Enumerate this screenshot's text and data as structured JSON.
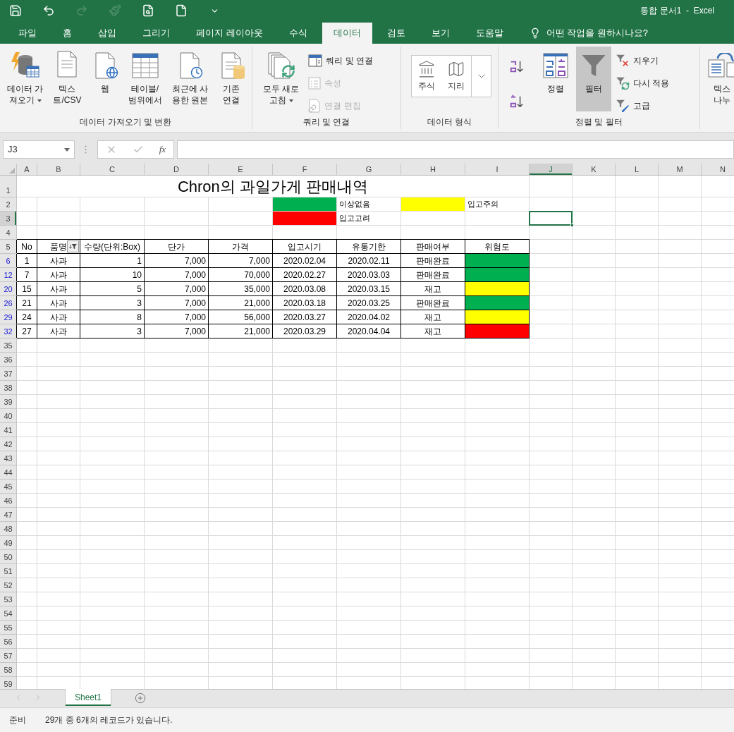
{
  "title_bar": {
    "quick_access": [
      {
        "kind": "save",
        "disabled": false
      },
      {
        "kind": "undo",
        "disabled": false
      },
      {
        "kind": "redo",
        "disabled": true
      },
      {
        "kind": "format",
        "disabled": true
      },
      {
        "kind": "preview",
        "disabled": false
      },
      {
        "kind": "new",
        "disabled": false
      },
      {
        "kind": "customize",
        "disabled": false
      }
    ],
    "title": "통합 문서1  -  Excel"
  },
  "ribbon_tabs": [
    {
      "label": "파일",
      "selected": false
    },
    {
      "label": "홈",
      "selected": false
    },
    {
      "label": "삽입",
      "selected": false
    },
    {
      "label": "그리기",
      "selected": false
    },
    {
      "label": "페이지 레이아웃",
      "selected": false
    },
    {
      "label": "수식",
      "selected": false
    },
    {
      "label": "데이터",
      "selected": true
    },
    {
      "label": "검토",
      "selected": false
    },
    {
      "label": "보기",
      "selected": false
    },
    {
      "label": "도움말",
      "selected": false
    }
  ],
  "tell_me": "어떤 작업을 원하시나요?",
  "ribbon_groups": [
    {
      "label": "데이터 가져오기 및 변환",
      "items": [
        {
          "kind": "large",
          "lines": [
            "데이터 가",
            "져오기"
          ],
          "dropdown": true,
          "on": false
        },
        {
          "kind": "large",
          "lines": [
            "텍스",
            "트/CSV"
          ],
          "dropdown": false,
          "on": false
        },
        {
          "kind": "large",
          "lines": [
            "웹"
          ],
          "dropdown": false,
          "on": false
        },
        {
          "kind": "large",
          "lines": [
            "테이블/",
            "범위에서"
          ],
          "dropdown": false,
          "on": false
        },
        {
          "kind": "large",
          "lines": [
            "최근에 사",
            "용한 원본"
          ],
          "dropdown": false,
          "on": false
        },
        {
          "kind": "large",
          "lines": [
            "기존",
            "연결"
          ],
          "dropdown": false,
          "on": false
        }
      ]
    },
    {
      "label": "쿼리 및 연결",
      "items": [
        {
          "kind": "large",
          "lines": [
            "모두 새로",
            "고침"
          ],
          "dropdown": true,
          "on": false
        },
        {
          "kind": "small_stack",
          "items": [
            {
              "label": "쿼리 및 연결",
              "disabled": false
            },
            {
              "label": "속성",
              "disabled": true
            },
            {
              "label": "연결 편집",
              "disabled": true
            }
          ]
        }
      ]
    },
    {
      "label": "데이터 형식",
      "items": [
        {
          "kind": "gallery",
          "options": [
            "주식",
            "지리"
          ]
        }
      ]
    },
    {
      "label": "정렬 및 필터",
      "items": [
        {
          "kind": "sort_pair"
        },
        {
          "kind": "large",
          "lines": [
            "정렬"
          ],
          "dropdown": false,
          "on": false
        },
        {
          "kind": "large",
          "lines": [
            "필터"
          ],
          "dropdown": false,
          "on": true
        },
        {
          "kind": "small_stack",
          "items": [
            {
              "label": "지우기",
              "disabled": false
            },
            {
              "label": "다시 적용",
              "disabled": false
            },
            {
              "label": "고급",
              "disabled": false
            }
          ]
        }
      ]
    },
    {
      "items": [
        {
          "kind": "large",
          "lines": [
            "텍스",
            "나누"
          ],
          "dropdown": false,
          "on": false
        }
      ]
    }
  ],
  "formula_bar": {
    "name_box": "J3",
    "function_label": "fx"
  },
  "sheet": {
    "columns": [
      {
        "label": "A",
        "selected": false
      },
      {
        "label": "B",
        "selected": false
      },
      {
        "label": "C",
        "selected": false
      },
      {
        "label": "D",
        "selected": false
      },
      {
        "label": "E",
        "selected": false
      },
      {
        "label": "F",
        "selected": false
      },
      {
        "label": "G",
        "selected": false
      },
      {
        "label": "H",
        "selected": false
      },
      {
        "label": "I",
        "selected": false
      },
      {
        "label": "J",
        "selected": true
      },
      {
        "label": "K",
        "selected": false
      },
      {
        "label": "L",
        "selected": false
      },
      {
        "label": "M",
        "selected": false
      },
      {
        "label": "N",
        "selected": false
      }
    ],
    "row_headers": [
      {
        "label": "1",
        "filtered": false,
        "selected": false
      },
      {
        "label": "2",
        "filtered": false,
        "selected": false
      },
      {
        "label": "3",
        "filtered": false,
        "selected": true
      },
      {
        "label": "4",
        "filtered": false,
        "selected": false
      },
      {
        "label": "5",
        "filtered": false,
        "selected": false
      },
      {
        "label": "6",
        "filtered": true,
        "selected": false
      },
      {
        "label": "12",
        "filtered": true,
        "selected": false
      },
      {
        "label": "20",
        "filtered": true,
        "selected": false
      },
      {
        "label": "26",
        "filtered": true,
        "selected": false
      },
      {
        "label": "29",
        "filtered": true,
        "selected": false
      },
      {
        "label": "32",
        "filtered": true,
        "selected": false
      },
      {
        "label": "35",
        "filtered": false,
        "selected": false
      },
      {
        "label": "36",
        "filtered": false,
        "selected": false
      },
      {
        "label": "37",
        "filtered": false,
        "selected": false
      },
      {
        "label": "38",
        "filtered": false,
        "selected": false
      },
      {
        "label": "39",
        "filtered": false,
        "selected": false
      },
      {
        "label": "40",
        "filtered": false,
        "selected": false
      },
      {
        "label": "41",
        "filtered": false,
        "selected": false
      },
      {
        "label": "42",
        "filtered": false,
        "selected": false
      },
      {
        "label": "43",
        "filtered": false,
        "selected": false
      },
      {
        "label": "44",
        "filtered": false,
        "selected": false
      },
      {
        "label": "45",
        "filtered": false,
        "selected": false
      },
      {
        "label": "46",
        "filtered": false,
        "selected": false
      },
      {
        "label": "47",
        "filtered": false,
        "selected": false
      },
      {
        "label": "48",
        "filtered": false,
        "selected": false
      },
      {
        "label": "49",
        "filtered": false,
        "selected": false
      },
      {
        "label": "50",
        "filtered": false,
        "selected": false
      },
      {
        "label": "51",
        "filtered": false,
        "selected": false
      },
      {
        "label": "52",
        "filtered": false,
        "selected": false
      },
      {
        "label": "53",
        "filtered": false,
        "selected": false
      },
      {
        "label": "54",
        "filtered": false,
        "selected": false
      },
      {
        "label": "55",
        "filtered": false,
        "selected": false
      },
      {
        "label": "56",
        "filtered": false,
        "selected": false
      },
      {
        "label": "57",
        "filtered": false,
        "selected": false
      },
      {
        "label": "58",
        "filtered": false,
        "selected": false
      },
      {
        "label": "59",
        "filtered": false,
        "selected": false
      }
    ],
    "title": "Chron의 과일가게 판매내역",
    "legend": [
      {
        "color": "#00b050",
        "label": "이상없음"
      },
      {
        "color": "#ffff00",
        "label": "입고주의"
      },
      {
        "color": "#ff0000",
        "label": "입고고려"
      }
    ],
    "table": {
      "headers": [
        {
          "label": "No",
          "filtered": false
        },
        {
          "label": "품명",
          "filtered": true
        },
        {
          "label": "수량(단위:Box)",
          "filtered": false
        },
        {
          "label": "단가",
          "filtered": false
        },
        {
          "label": "가격",
          "filtered": false
        },
        {
          "label": "입고시기",
          "filtered": false
        },
        {
          "label": "유통기한",
          "filtered": false
        },
        {
          "label": "판매여부",
          "filtered": false
        },
        {
          "label": "위험도",
          "filtered": false
        }
      ],
      "records": [
        {
          "cells": [
            "1",
            "사과",
            "1",
            "7,000",
            "7,000",
            "2020.02.04",
            "2020.02.11",
            "판매완료"
          ],
          "color": "#00b050"
        },
        {
          "cells": [
            "7",
            "사과",
            "10",
            "7,000",
            "70,000",
            "2020.02.27",
            "2020.03.03",
            "판매완료"
          ],
          "color": "#00b050"
        },
        {
          "cells": [
            "15",
            "사과",
            "5",
            "7,000",
            "35,000",
            "2020.03.08",
            "2020.03.15",
            "재고"
          ],
          "color": "#ffff00"
        },
        {
          "cells": [
            "21",
            "사과",
            "3",
            "7,000",
            "21,000",
            "2020.03.18",
            "2020.03.25",
            "판매완료"
          ],
          "color": "#00b050"
        },
        {
          "cells": [
            "24",
            "사과",
            "8",
            "7,000",
            "56,000",
            "2020.03.27",
            "2020.04.02",
            "재고"
          ],
          "color": "#ffff00"
        },
        {
          "cells": [
            "27",
            "사과",
            "3",
            "7,000",
            "21,000",
            "2020.03.29",
            "2020.04.04",
            "재고"
          ],
          "color": "#ff0000"
        }
      ]
    }
  },
  "sheet_tabs": [
    {
      "label": "Sheet1",
      "selected": true
    }
  ],
  "status_bar": {
    "mode": "준비",
    "message": "29개 중 6개의 레코드가 있습니다."
  }
}
